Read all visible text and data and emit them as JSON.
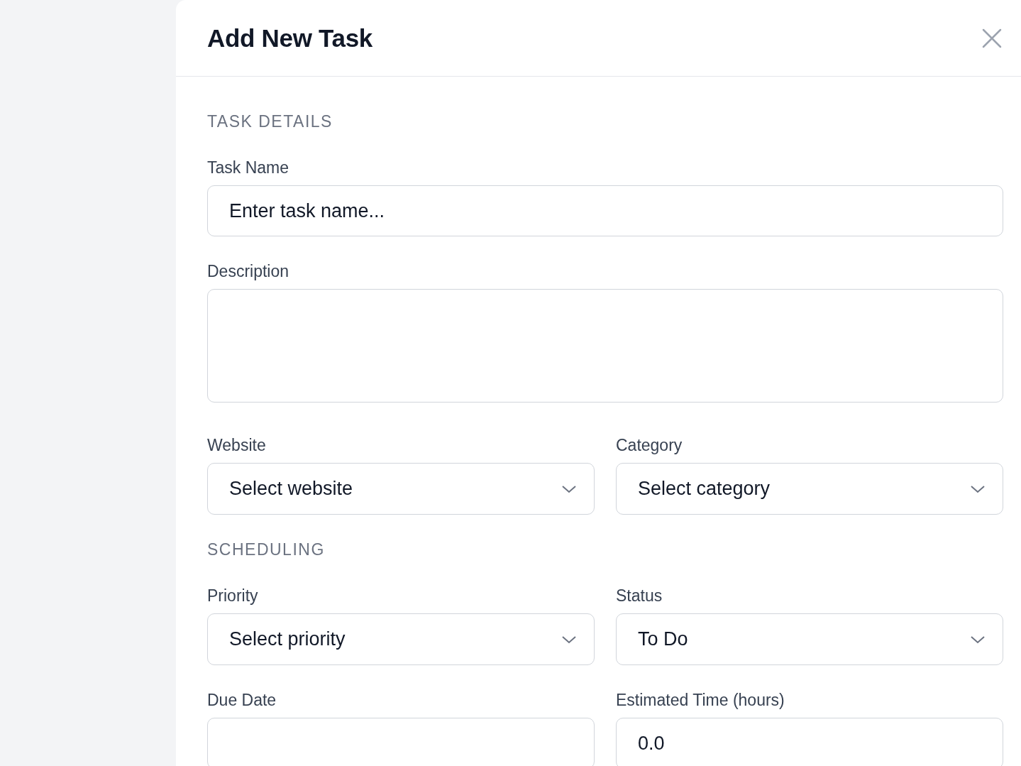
{
  "dialog": {
    "title": "Add New Task"
  },
  "sections": [
    {
      "heading": "TASK DETAILS",
      "rows": [
        [
          {
            "kind": "text",
            "label": "Task Name",
            "placeholder": "Enter task name..."
          }
        ],
        [
          {
            "kind": "textarea",
            "label": "Description"
          }
        ],
        [
          {
            "kind": "select",
            "label": "Website",
            "value": "Select website"
          },
          {
            "kind": "select",
            "label": "Category",
            "value": "Select category"
          }
        ]
      ]
    },
    {
      "heading": "SCHEDULING",
      "rows": [
        [
          {
            "kind": "select",
            "label": "Priority",
            "value": "Select priority"
          },
          {
            "kind": "select",
            "label": "Status",
            "value": "To Do"
          }
        ],
        [
          {
            "kind": "text",
            "label": "Due Date"
          },
          {
            "kind": "text",
            "label": "Estimated Time (hours)",
            "value": "0.0"
          }
        ]
      ]
    }
  ]
}
